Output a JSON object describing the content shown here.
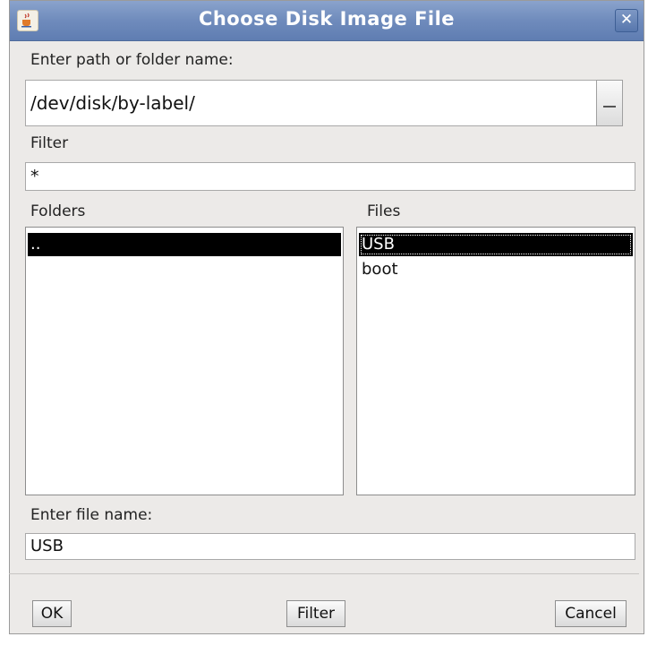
{
  "window": {
    "title": "Choose Disk Image File",
    "close_glyph": "✕"
  },
  "path": {
    "label": "Enter path or folder name:",
    "value": "/dev/disk/by-label/"
  },
  "filter": {
    "label": "Filter",
    "value": "*"
  },
  "folders": {
    "label": "Folders",
    "items": [
      ".."
    ],
    "selected_index": 0
  },
  "files": {
    "label": "Files",
    "items": [
      "USB",
      "boot"
    ],
    "selected_index": 0
  },
  "filename": {
    "label": "Enter file name:",
    "value": "USB"
  },
  "buttons": {
    "ok": "OK",
    "filter": "Filter",
    "cancel": "Cancel"
  },
  "colors": {
    "title_bar": "#6f8bbc",
    "selection": "#000000",
    "dialog_bg": "#eceae8"
  },
  "icons": {
    "app": "java-cup-icon",
    "close": "close-icon",
    "browse": "browse-icon"
  }
}
